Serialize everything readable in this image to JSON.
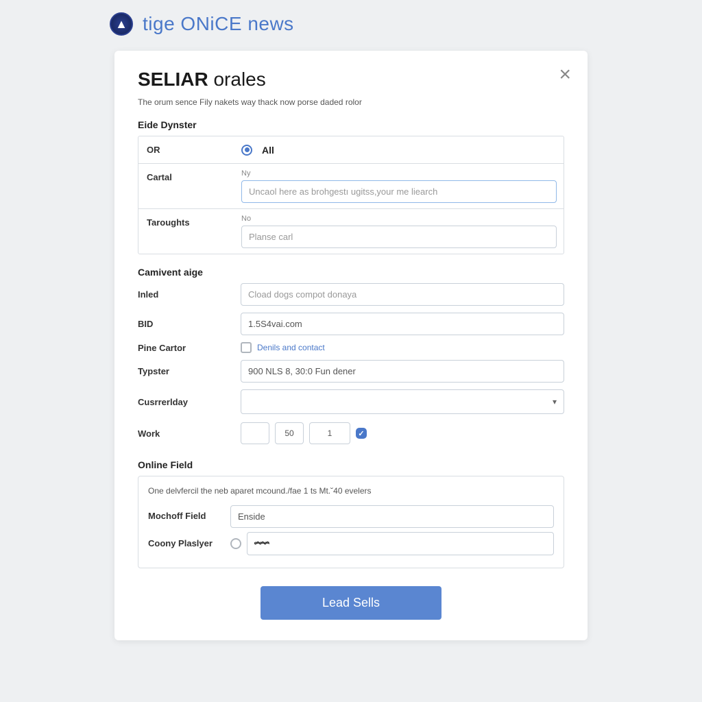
{
  "header": {
    "title": "tige ONiCE news"
  },
  "modal": {
    "title_bold": "SELIAR",
    "title_light": "orales",
    "description": "The orum sence Fily nakets way thack now porse daded rolor",
    "close_glyph": "×",
    "section1_label": "Eide Dynster",
    "rows1": {
      "or_label": "OR",
      "or_option": "All",
      "cartal_label": "Cartal",
      "cartal_sub": "Ny",
      "cartal_placeholder": "Uncaol here as brohgestı ugitss,your me liearch",
      "taroughts_label": "Taroughts",
      "taroughts_sub": "No",
      "taroughts_placeholder": "Planse carl"
    },
    "section2_label": "Camivent aige",
    "rows2": {
      "inled_label": "Inled",
      "inled_placeholder": "Cload dogs compot donaya",
      "bid_label": "BID",
      "bid_value": "1.5S4vai.com",
      "pine_label": "Pine Cartor",
      "pine_check": "Denils and contact",
      "typster_label": "Typster",
      "typster_value": "900 NLS 8, 30:0 Fun dener",
      "currday_label": "Cusrrerlday",
      "work_label": "Work",
      "work_v2": "50",
      "work_v3": "1",
      "work_dots": "··"
    },
    "section3_label": "Online Field",
    "info": {
      "text": "One delvfercil the neb aparet mcound./fae 1 ts Mt.˘40 evelers",
      "mochoff_label": "Mochoff Field",
      "mochoff_value": "Enside",
      "coony_label": "Coony Plaslyer"
    },
    "submit_label": "Lead Sells"
  }
}
